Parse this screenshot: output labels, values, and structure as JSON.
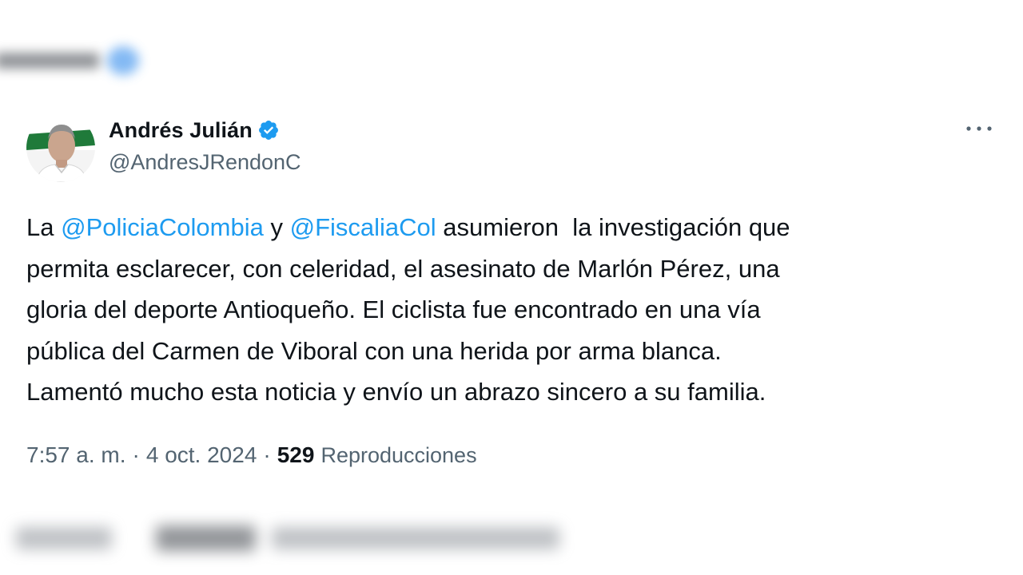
{
  "author": {
    "display_name": "Andrés Julián",
    "handle": "@AndresJRendonC"
  },
  "icons": {
    "verified": "verified-badge-icon",
    "more": "more-options-icon",
    "avatar": "profile-photo"
  },
  "colors": {
    "mention": "#1d9bf0",
    "verified": "#1d9bf0",
    "text": "#0f1419",
    "muted": "#536471"
  },
  "tweet": {
    "lines": [
      {
        "t0": "La ",
        "m1": "@PoliciaColombia",
        "t1": " y ",
        "m2": "@FiscaliaCol",
        "t2": " asumieron  la investigación que"
      },
      {
        "text": "permita esclarecer, con celeridad, el asesinato de Marlón Pérez, una"
      },
      {
        "text": "gloria del deporte Antioqueño. El ciclista fue encontrado en una vía"
      },
      {
        "text": "pública del Carmen de Viboral con una herida por arma blanca."
      },
      {
        "text": "Lamentó mucho esta noticia y envío un abrazo sincero a su familia."
      }
    ]
  },
  "meta": {
    "time": "7:57 a. m.",
    "separator": "·",
    "date": "4 oct. 2024",
    "views_count": "529",
    "views_label": "Reproducciones"
  }
}
